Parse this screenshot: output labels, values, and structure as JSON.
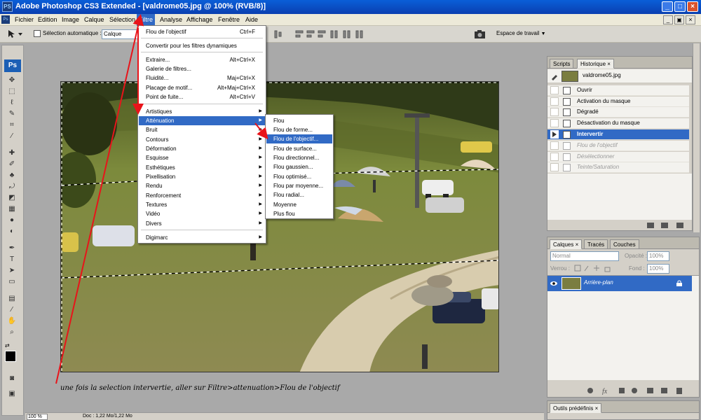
{
  "window": {
    "app_icon": "PS",
    "title": "Adobe Photoshop CS3 Extended - [valdrome05.jpg @ 100% (RVB/8)]",
    "minimize": "_",
    "maximize": "□",
    "close": "×",
    "inner_minimize": "_",
    "inner_restore": "▣",
    "inner_close": "×"
  },
  "menubar": {
    "app_icon": "Ps",
    "items": [
      "Fichier",
      "Edition",
      "Image",
      "Calque",
      "Sélection",
      "Filtre",
      "Analyse",
      "Affichage",
      "Fenêtre",
      "Aide"
    ],
    "active_index": 5
  },
  "options_bar": {
    "auto_select_label": "Sélection automatique :",
    "auto_select_value": "Calque",
    "workspace_label": "Espace de travail"
  },
  "toolbox": {
    "logo": "Ps"
  },
  "filter_menu": {
    "items": [
      {
        "label": "Flou de l'objectif",
        "shortcut": "Ctrl+F"
      },
      {
        "label": "Convertir pour les filtres dynamiques",
        "shortcut": ""
      },
      {
        "label": "Extraire...",
        "shortcut": "Alt+Ctrl+X"
      },
      {
        "label": "Galerie de filtres...",
        "shortcut": ""
      },
      {
        "label": "Fluidité...",
        "shortcut": "Maj+Ctrl+X"
      },
      {
        "label": "Placage de motif...",
        "shortcut": "Alt+Maj+Ctrl+X"
      },
      {
        "label": "Point de fuite...",
        "shortcut": "Alt+Ctrl+V"
      },
      {
        "label": "Artistiques",
        "shortcut": ""
      },
      {
        "label": "Atténuation",
        "shortcut": ""
      },
      {
        "label": "Bruit",
        "shortcut": ""
      },
      {
        "label": "Contours",
        "shortcut": ""
      },
      {
        "label": "Déformation",
        "shortcut": ""
      },
      {
        "label": "Esquisse",
        "shortcut": ""
      },
      {
        "label": "Esthétiques",
        "shortcut": ""
      },
      {
        "label": "Pixellisation",
        "shortcut": ""
      },
      {
        "label": "Rendu",
        "shortcut": ""
      },
      {
        "label": "Renforcement",
        "shortcut": ""
      },
      {
        "label": "Textures",
        "shortcut": ""
      },
      {
        "label": "Vidéo",
        "shortcut": ""
      },
      {
        "label": "Divers",
        "shortcut": ""
      },
      {
        "label": "Digimarc",
        "shortcut": ""
      }
    ]
  },
  "blur_submenu": {
    "items": [
      "Flou",
      "Flou de forme...",
      "Flou de l'objectif...",
      "Flou de surface...",
      "Flou directionnel...",
      "Flou gaussien...",
      "Flou optimisé...",
      "Flou par moyenne...",
      "Flou radial...",
      "Moyenne",
      "Plus flou"
    ],
    "highlighted_index": 2
  },
  "history_panel": {
    "tabs": [
      "Scripts",
      "Historique"
    ],
    "close": "×",
    "snapshot": "valdrome05.jpg",
    "steps": [
      "Ouvrir",
      "Activation du masque",
      "Dégradé",
      "Désactivation du masque",
      "Intervertir",
      "Flou de l'objectif",
      "Désélectionner",
      "Teinte/Saturation"
    ],
    "current_index": 4
  },
  "layers_panel": {
    "tabs": [
      "Calques",
      "Tracés",
      "Couches"
    ],
    "close": "×",
    "blend_mode": "Normal",
    "opacity_label": "Opacité :",
    "opacity_value": "100%",
    "lock_label": "Verrou :",
    "fill_label": "Fond :",
    "fill_value": "100%",
    "layers": [
      "Arrière-plan"
    ]
  },
  "presets_panel": {
    "tab": "Outils prédéfinis",
    "close": "×"
  },
  "statusbar": {
    "zoom": "100 %",
    "doc": "Doc : 1,22 Mo/1,22 Mo"
  },
  "annotation": {
    "text": "une fois la selection intervertie, aller sur Filtre>attenuation>Flou de l'objectif"
  },
  "colors": {
    "title_blue": "#0a4fc8",
    "menu_highlight": "#316ac5",
    "annotation_red": "#e8141a"
  }
}
